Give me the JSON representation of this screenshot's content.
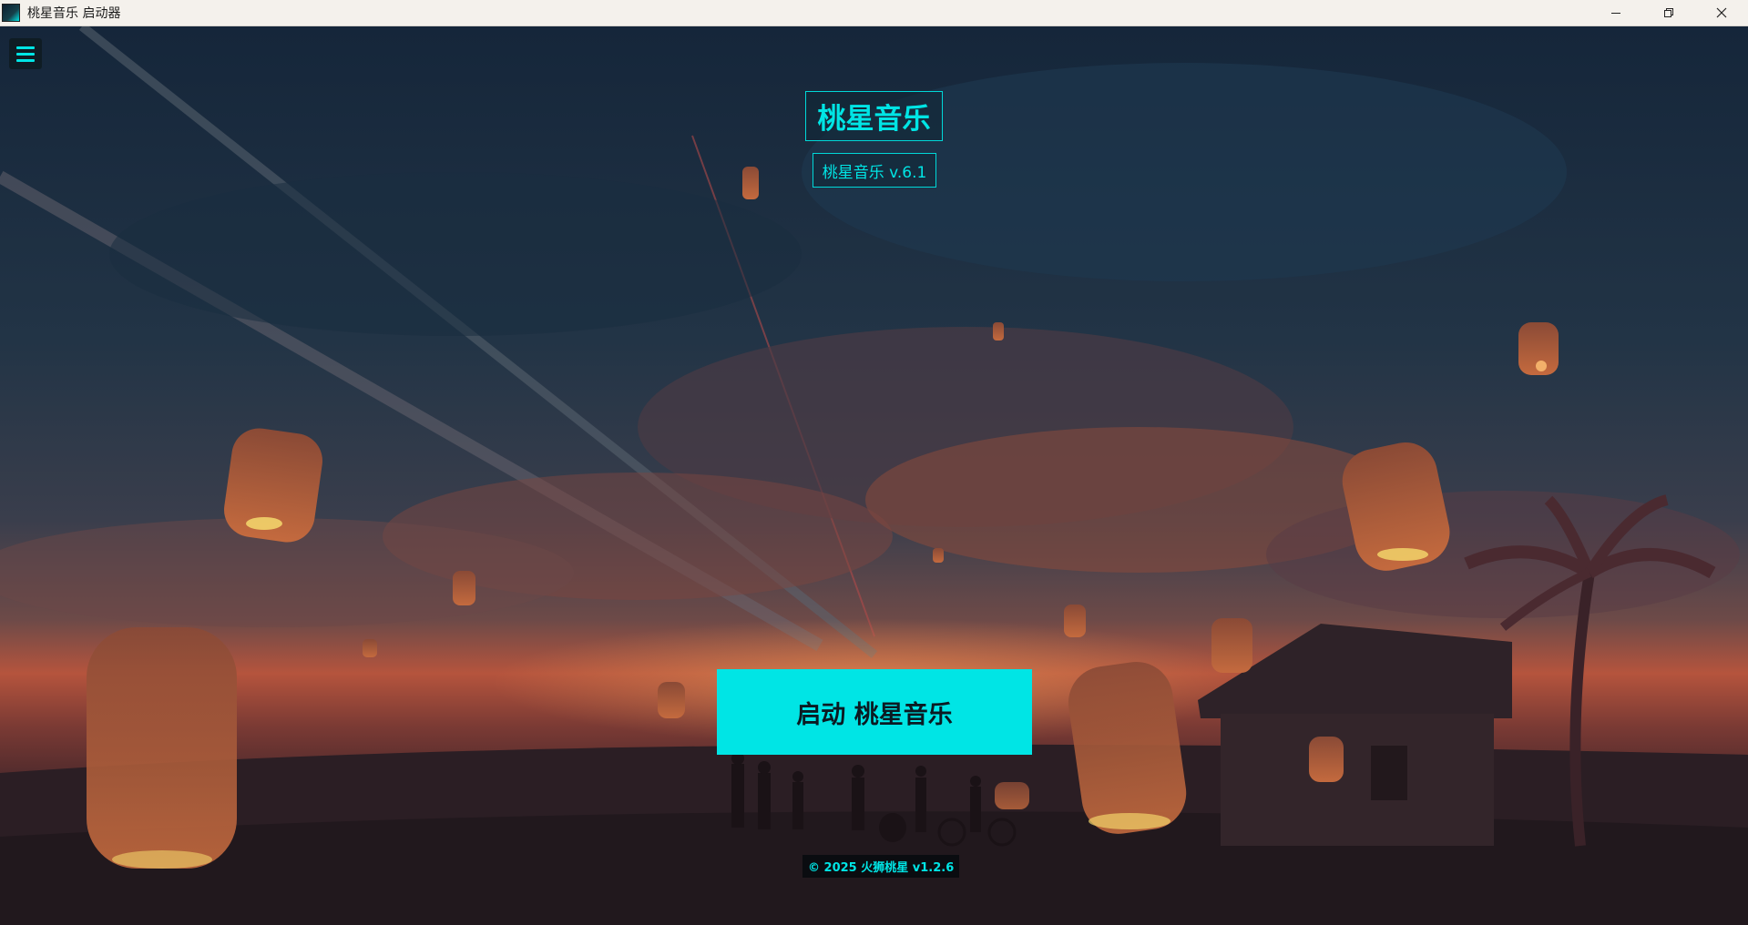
{
  "window": {
    "title": "桃星音乐 启动器",
    "controls": {
      "minimize_icon": "minimize-icon",
      "maximize_icon": "restore-icon",
      "close_icon": "close-icon"
    }
  },
  "menu": {
    "icon": "hamburger-menu-icon"
  },
  "header": {
    "title": "桃星音乐",
    "version": "桃星音乐 v.6.1"
  },
  "main": {
    "launch_label": "启动 桃星音乐"
  },
  "footer": {
    "copyright": "© 2025 火狮桃星 v1.2.6"
  },
  "theme": {
    "accent": "#00e5e5",
    "sky_top": "#1b2a3a",
    "horizon": "#b04a35",
    "ground": "#2a1c20"
  }
}
